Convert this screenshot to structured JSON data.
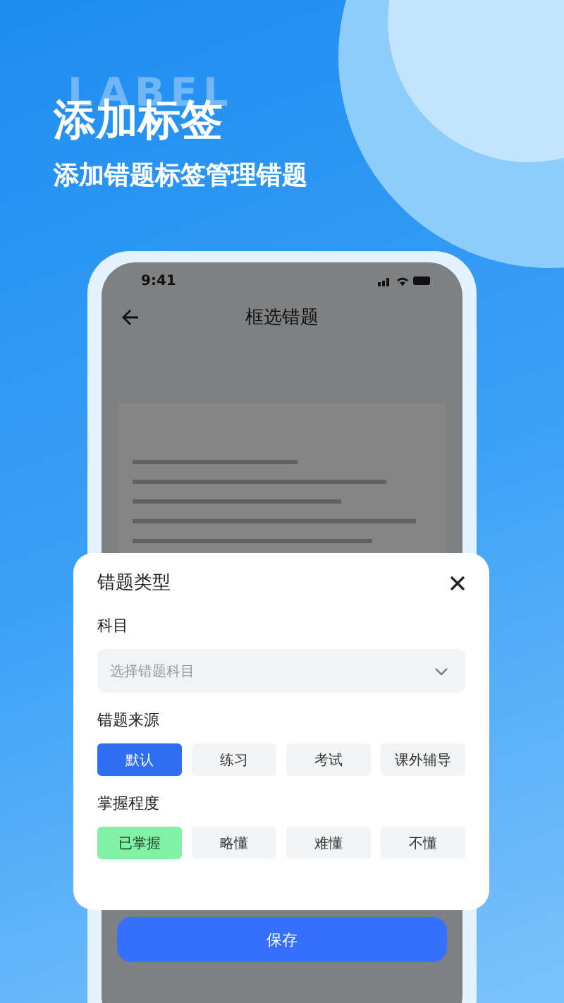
{
  "backdrop_text": "LABEL",
  "headline": "添加标签",
  "subtitle": "添加错题标签管理错题",
  "phone": {
    "status_bar": {
      "time": "9:41"
    },
    "nav": {
      "title": "框选错题"
    },
    "save_button": "保存"
  },
  "sheet": {
    "title": "错题类型",
    "subject": {
      "label": "科目",
      "placeholder": "选择错题科目"
    },
    "groups": [
      {
        "kind": "source",
        "label": "错题来源",
        "options": [
          {
            "label": "默认",
            "selected": true
          },
          {
            "label": "练习",
            "selected": false
          },
          {
            "label": "考试",
            "selected": false
          },
          {
            "label": "课外辅导",
            "selected": false
          }
        ]
      },
      {
        "kind": "mastery",
        "label": "掌握程度",
        "options": [
          {
            "label": "已掌握",
            "selected": true
          },
          {
            "label": "略懂",
            "selected": false
          },
          {
            "label": "难懂",
            "selected": false
          },
          {
            "label": "不懂",
            "selected": false
          }
        ]
      }
    ]
  }
}
